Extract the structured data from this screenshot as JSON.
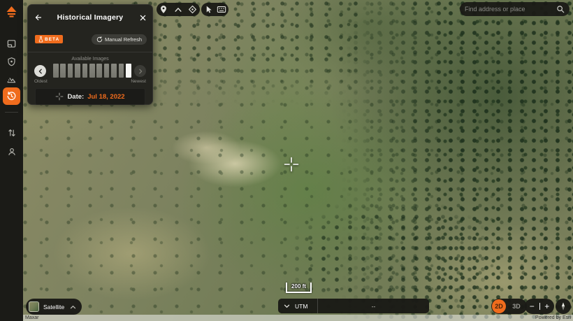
{
  "colors": {
    "accent": "#f06c1d",
    "panel_bg": "#24241f",
    "sidebar_bg": "#1b1b17"
  },
  "sidebar": {
    "items": [
      {
        "id": "basemap-layers"
      },
      {
        "id": "shield-location"
      },
      {
        "id": "terrain-hazard"
      },
      {
        "id": "historical-imagery",
        "active": true
      },
      {
        "id": "sort-filters"
      },
      {
        "id": "account"
      }
    ]
  },
  "panel": {
    "title": "Historical Imagery",
    "beta": "BETA",
    "manual_refresh": "Manual Refresh",
    "available_images": "Available Images",
    "oldest": "Oldest",
    "newest": "Newest",
    "date_label": "Date:",
    "date_value": "Jul 18, 2022",
    "strip": {
      "bars": [
        "g",
        "g",
        "g",
        "g",
        "g",
        "g",
        "g",
        "g",
        "g",
        "g",
        "w"
      ]
    }
  },
  "search": {
    "placeholder": "Find address or place"
  },
  "map": {
    "basemap_label": "Satellite",
    "scale_label": "200 ft",
    "coord_system": "UTM",
    "coord_value": "--",
    "view_2d": "2D",
    "view_3d": "3D"
  },
  "attribution": {
    "left": "Maxar",
    "right": "Powered by Esri"
  }
}
